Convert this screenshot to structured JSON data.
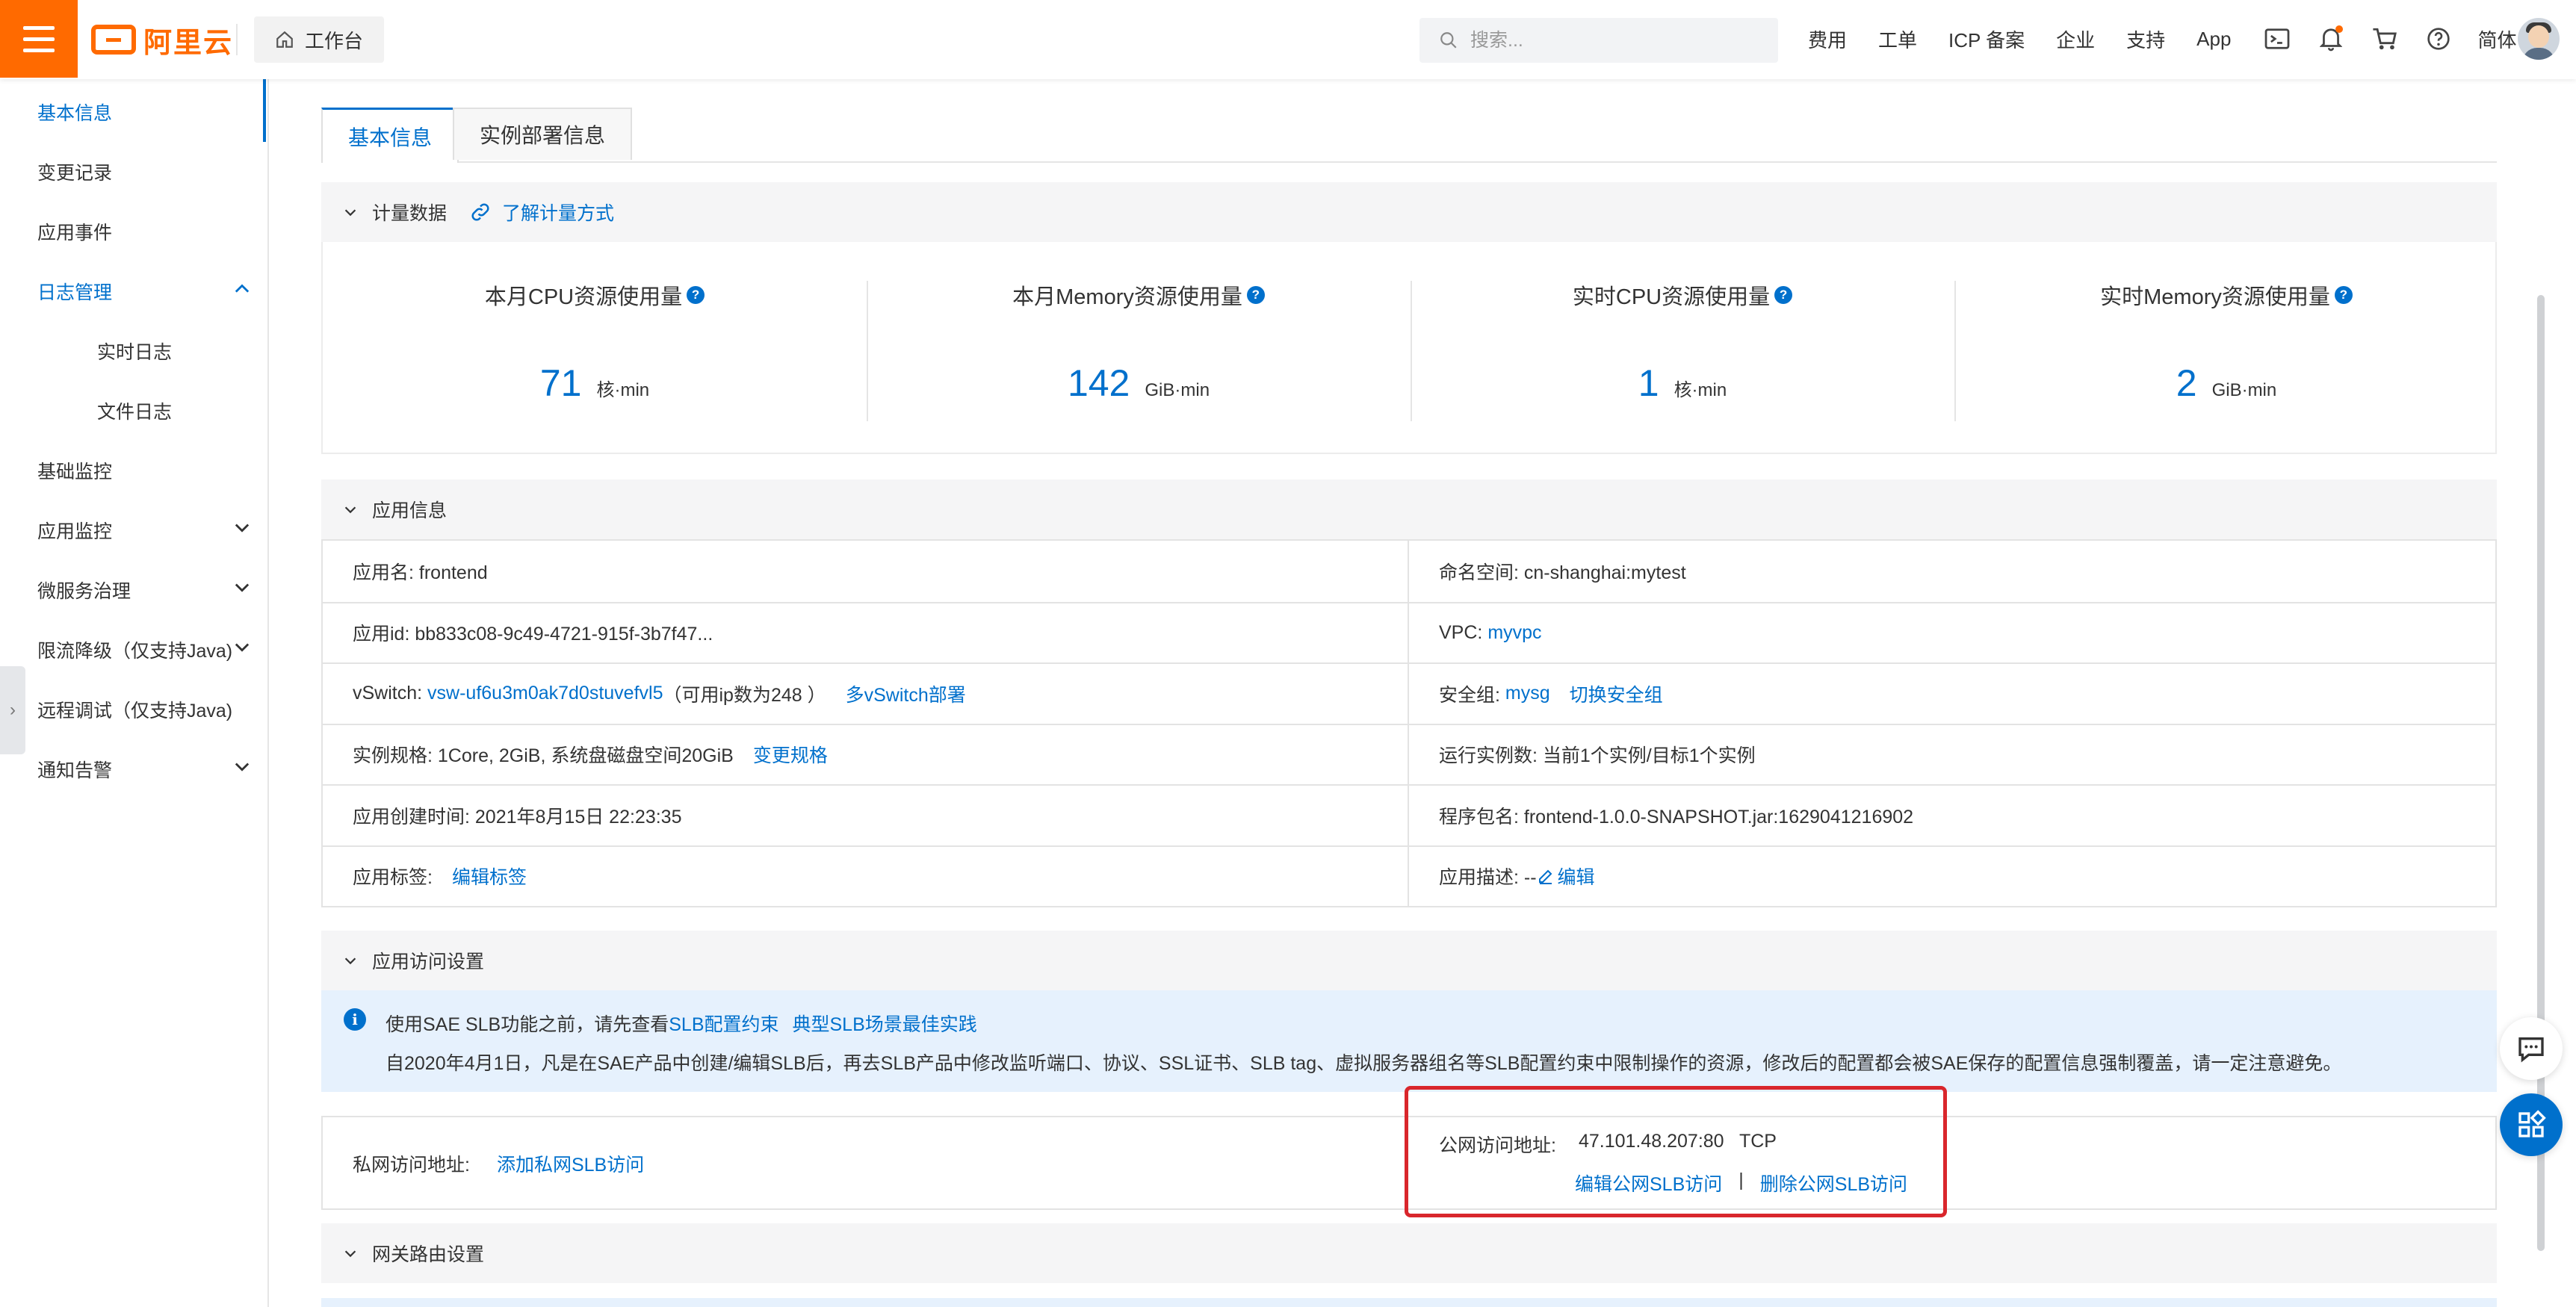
{
  "topbar": {
    "brand": "阿里云",
    "workbench": "工作台",
    "search_placeholder": "搜索...",
    "nav": [
      "费用",
      "工单",
      "ICP 备案",
      "企业",
      "支持",
      "App"
    ],
    "lang": "简体",
    "icons": [
      "terminal-icon",
      "bell-icon",
      "cart-icon",
      "help-icon"
    ]
  },
  "sidebar": {
    "items": [
      {
        "label": "基本信息"
      },
      {
        "label": "变更记录"
      },
      {
        "label": "应用事件"
      },
      {
        "label": "日志管理"
      },
      {
        "label": "实时日志"
      },
      {
        "label": "文件日志"
      },
      {
        "label": "基础监控"
      },
      {
        "label": "应用监控"
      },
      {
        "label": "微服务治理"
      },
      {
        "label": "限流降级（仅支持Java)"
      },
      {
        "label": "远程调试（仅支持Java)"
      },
      {
        "label": "通知告警"
      }
    ]
  },
  "tabs": [
    "基本信息",
    "实例部署信息"
  ],
  "metering": {
    "title": "计量数据",
    "link": "了解计量方式",
    "metrics": [
      {
        "label": "本月CPU资源使用量",
        "value": "71",
        "unit": "核·min"
      },
      {
        "label": "本月Memory资源使用量",
        "value": "142",
        "unit": "GiB·min"
      },
      {
        "label": "实时CPU资源使用量",
        "value": "1",
        "unit": "核·min"
      },
      {
        "label": "实时Memory资源使用量",
        "value": "2",
        "unit": "GiB·min"
      }
    ]
  },
  "app_info": {
    "title": "应用信息",
    "name": "应用名: frontend",
    "namespace": "命名空间: cn-shanghai:mytest",
    "app_id": "应用id: bb833c08-9c49-4721-915f-3b7f47...",
    "vpc_label": "VPC:",
    "vpc_value": "myvpc",
    "vswitch_label": "vSwitch:",
    "vswitch_value": "vsw-uf6u3m0ak7d0stuvefvl5",
    "vswitch_note": "（可用ip数为248 ）",
    "vswitch_link": "多vSwitch部署",
    "sg_label": "安全组:",
    "sg_value": "mysg",
    "sg_link": "切换安全组",
    "spec": "实例规格: 1Core, 2GiB, 系统盘磁盘空间20GiB",
    "spec_link": "变更规格",
    "instances": "运行实例数: 当前1个实例/目标1个实例",
    "created": "应用创建时间: 2021年8月15日 22:23:35",
    "package": "程序包名: frontend-1.0.0-SNAPSHOT.jar:1629041216902",
    "tags_label": "应用标签:",
    "tags_link": "编辑标签",
    "desc_label": "应用描述: --",
    "desc_link": "编辑"
  },
  "access": {
    "title": "应用访问设置",
    "notice_prefix": "使用SAE SLB功能之前，请先查看",
    "notice_link1": "SLB配置约束",
    "notice_link2": "典型SLB场景最佳实践",
    "notice_line2": "自2020年4月1日，凡是在SAE产品中创建/编辑SLB后，再去SLB产品中修改监听端口、协议、SSL证书、SLB tag、虚拟服务器组名等SLB配置约束中限制操作的资源，修改后的配置都会被SAE保存的配置信息强制覆盖，请一定注意避免。",
    "private_label": "私网访问地址:",
    "private_link": "添加私网SLB访问",
    "public_label": "公网访问地址:",
    "public_value": "47.101.48.207:80   TCP",
    "public_edit": "编辑公网SLB访问",
    "separator": "|",
    "public_delete": "删除公网SLB访问"
  },
  "gateway": {
    "title": "网关路由设置"
  },
  "colors": {
    "brand_orange": "#ff6a00",
    "link_blue": "#0070cc",
    "highlight_red": "#d9262c"
  }
}
